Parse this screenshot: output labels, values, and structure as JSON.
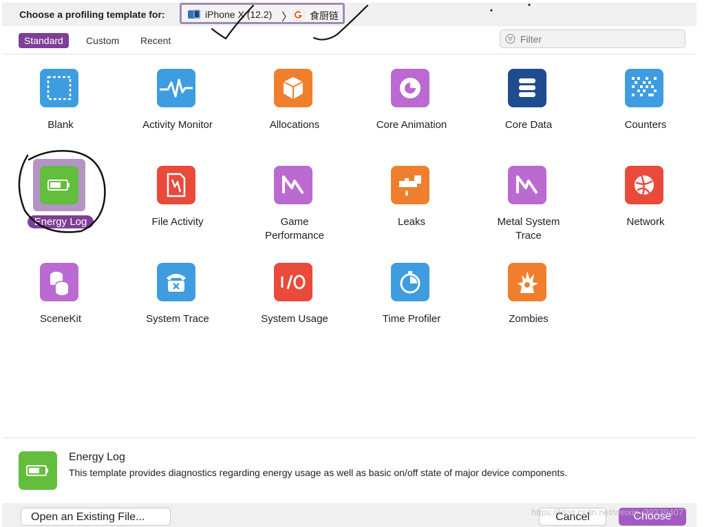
{
  "window": {
    "title_label": "Choose a profiling template for:",
    "device_name": "iPhone X (12.2)",
    "app_name": "食厨链"
  },
  "tabs": [
    {
      "label": "Standard",
      "active": true
    },
    {
      "label": "Custom",
      "active": false
    },
    {
      "label": "Recent",
      "active": false
    }
  ],
  "filter": {
    "placeholder": "Filter",
    "value": ""
  },
  "templates": [
    {
      "label": "Blank",
      "icon": "blank-icon",
      "color": "#3d9de0"
    },
    {
      "label": "Activity Monitor",
      "icon": "activity-monitor-icon",
      "color": "#3d9de0"
    },
    {
      "label": "Allocations",
      "icon": "allocations-icon",
      "color": "#ef7f2c"
    },
    {
      "label": "Core Animation",
      "icon": "core-animation-icon",
      "color": "#bb6ad1"
    },
    {
      "label": "Core Data",
      "icon": "core-data-icon",
      "color": "#1f4c8f"
    },
    {
      "label": "Counters",
      "icon": "counters-icon",
      "color": "#3d9de0"
    },
    {
      "label": "Energy Log",
      "icon": "battery-icon",
      "color": "#62be3c",
      "selected": true
    },
    {
      "label": "File Activity",
      "icon": "file-activity-icon",
      "color": "#e94a3a"
    },
    {
      "label": "Game\nPerformance",
      "icon": "game-performance-icon",
      "color": "#bb6ad1"
    },
    {
      "label": "Leaks",
      "icon": "leaks-icon",
      "color": "#ef7f2c"
    },
    {
      "label": "Metal System\nTrace",
      "icon": "metal-system-trace-icon",
      "color": "#bb6ad1"
    },
    {
      "label": "Network",
      "icon": "network-icon",
      "color": "#e94a3a"
    },
    {
      "label": "SceneKit",
      "icon": "scenekit-icon",
      "color": "#bb6ad1"
    },
    {
      "label": "System Trace",
      "icon": "system-trace-icon",
      "color": "#3d9de0"
    },
    {
      "label": "System Usage",
      "icon": "system-usage-icon",
      "color": "#e94a3a"
    },
    {
      "label": "Time Profiler",
      "icon": "time-profiler-icon",
      "color": "#3d9de0"
    },
    {
      "label": "Zombies",
      "icon": "zombies-icon",
      "color": "#ef7f2c"
    }
  ],
  "description": {
    "title": "Energy Log",
    "text": "This template provides diagnostics regarding energy usage as well as basic on/off state of major device components."
  },
  "footer": {
    "open_label": "Open an Existing File...",
    "cancel_label": "Cancel",
    "choose_label": "Choose"
  },
  "watermark": "https://blog.csdn.net/weixin_39339407",
  "colors": {
    "accent": "#7d3f97",
    "selection_highlight": "#b494c4",
    "choose_button": "#a35ac2"
  }
}
